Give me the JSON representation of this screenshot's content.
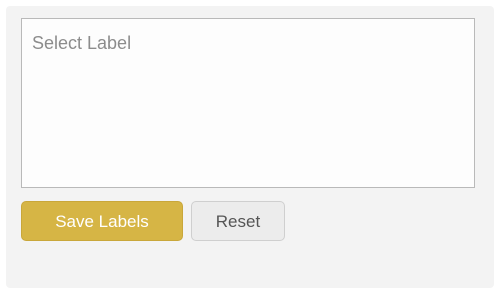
{
  "label_selector": {
    "placeholder": "Select Label"
  },
  "actions": {
    "save_label": "Save Labels",
    "reset_label": "Reset"
  },
  "colors": {
    "save_button_bg": "#d6b545",
    "reset_button_bg": "#ececec",
    "panel_bg": "#f3f3f3"
  }
}
